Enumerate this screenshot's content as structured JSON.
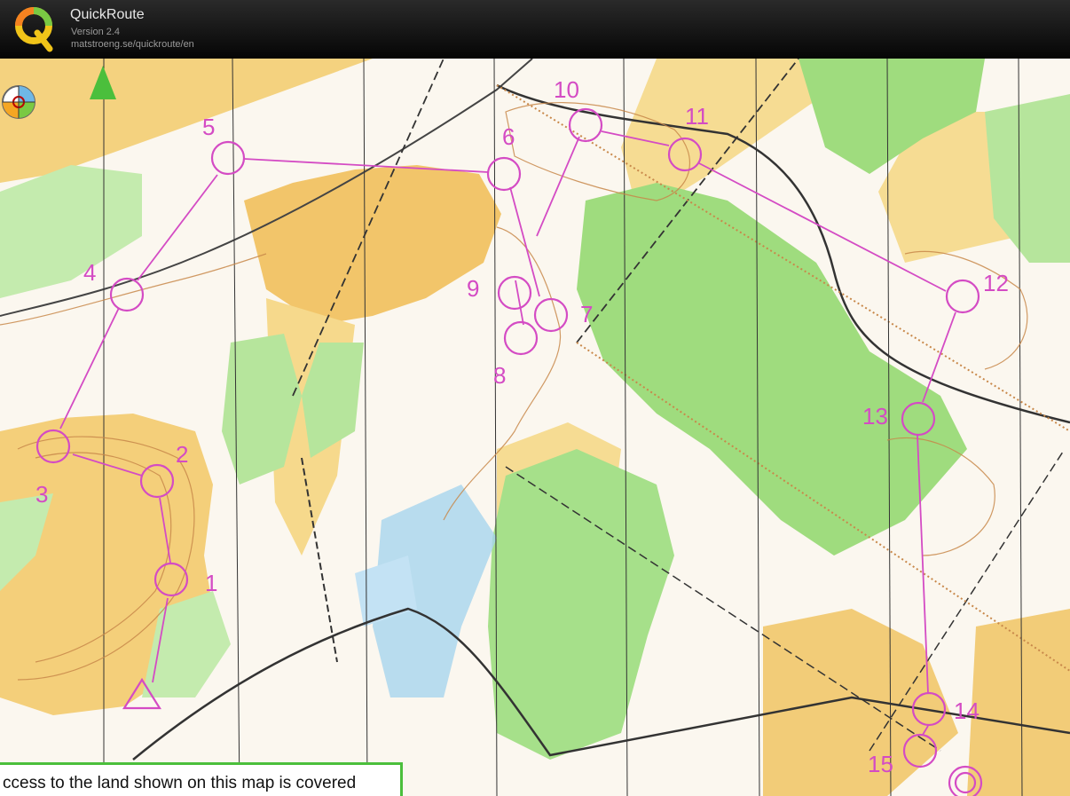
{
  "app": {
    "title": "QuickRoute",
    "version": "Version 2.4",
    "url": "matstroeng.se/quickroute/en"
  },
  "map": {
    "course_controls": [
      {
        "label": "1"
      },
      {
        "label": "2"
      },
      {
        "label": "3"
      },
      {
        "label": "4"
      },
      {
        "label": "5"
      },
      {
        "label": "6"
      },
      {
        "label": "7"
      },
      {
        "label": "8"
      },
      {
        "label": "9"
      },
      {
        "label": "10"
      },
      {
        "label": "11"
      },
      {
        "label": "12"
      },
      {
        "label": "13"
      },
      {
        "label": "14"
      },
      {
        "label": "15"
      }
    ],
    "notice_text": "ccess to the land shown on this map is covered"
  },
  "colors": {
    "course": "#d44bc4",
    "forest_green": "#9fdc7e",
    "open_yellow": "#f2c56a",
    "water_blue": "#a8d4ee",
    "contour_brown": "#c8884a",
    "notice_border": "#4bbf3c"
  },
  "icons": [
    "quickroute-logo-icon",
    "compass-icon",
    "north-arrow-icon"
  ]
}
